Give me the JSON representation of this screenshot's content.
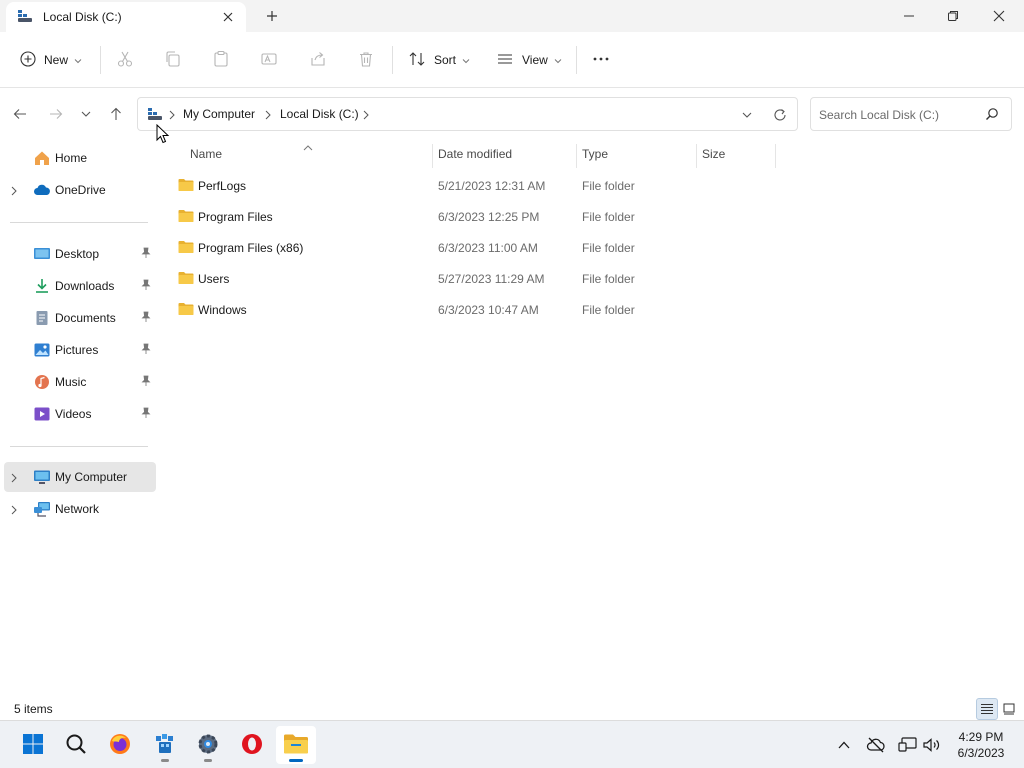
{
  "window": {
    "tab_title": "Local Disk (C:)",
    "tab_icon": "drive-icon"
  },
  "toolbar": {
    "new_label": "New",
    "sort_label": "Sort",
    "view_label": "View",
    "icons": [
      "cut-icon",
      "copy-icon",
      "paste-icon",
      "rename-icon",
      "share-icon",
      "delete-icon",
      "more-icon"
    ]
  },
  "address": {
    "crumbs": [
      "My Computer",
      "Local Disk (C:)"
    ]
  },
  "search": {
    "placeholder": "Search Local Disk (C:)"
  },
  "sidebar": {
    "items": [
      {
        "label": "Home",
        "icon": "home-icon",
        "chevron": false,
        "pinned": false
      },
      {
        "label": "OneDrive",
        "icon": "cloud-icon",
        "chevron": true,
        "pinned": false
      },
      {
        "label": "Desktop",
        "icon": "desktop-icon",
        "chevron": false,
        "pinned": true
      },
      {
        "label": "Downloads",
        "icon": "download-icon",
        "chevron": false,
        "pinned": true
      },
      {
        "label": "Documents",
        "icon": "document-icon",
        "chevron": false,
        "pinned": true
      },
      {
        "label": "Pictures",
        "icon": "pictures-icon",
        "chevron": false,
        "pinned": true
      },
      {
        "label": "Music",
        "icon": "music-icon",
        "chevron": false,
        "pinned": true
      },
      {
        "label": "Videos",
        "icon": "videos-icon",
        "chevron": false,
        "pinned": true
      },
      {
        "label": "My Computer",
        "icon": "computer-icon",
        "chevron": true,
        "pinned": false,
        "selected": true
      },
      {
        "label": "Network",
        "icon": "network-icon",
        "chevron": true,
        "pinned": false
      }
    ]
  },
  "columns": {
    "name": "Name",
    "date": "Date modified",
    "type": "Type",
    "size": "Size"
  },
  "files": [
    {
      "name": "PerfLogs",
      "date": "5/21/2023 12:31 AM",
      "type": "File folder",
      "size": ""
    },
    {
      "name": "Program Files",
      "date": "6/3/2023 12:25 PM",
      "type": "File folder",
      "size": ""
    },
    {
      "name": "Program Files (x86)",
      "date": "6/3/2023 11:00 AM",
      "type": "File folder",
      "size": ""
    },
    {
      "name": "Users",
      "date": "5/27/2023 11:29 AM",
      "type": "File folder",
      "size": ""
    },
    {
      "name": "Windows",
      "date": "6/3/2023 10:47 AM",
      "type": "File folder",
      "size": ""
    }
  ],
  "status": {
    "item_count": "5 items"
  },
  "taskbar": {
    "apps": [
      "windows-start-icon",
      "search-icon",
      "firefox-icon",
      "app-icon",
      "settings-icon",
      "opera-icon",
      "file-explorer-icon"
    ],
    "clock": {
      "time": "4:29 PM",
      "date": "6/3/2023"
    }
  },
  "colors": {
    "folder": "#f7c948",
    "folder_dark": "#e8b130",
    "accent": "#0067c0"
  }
}
